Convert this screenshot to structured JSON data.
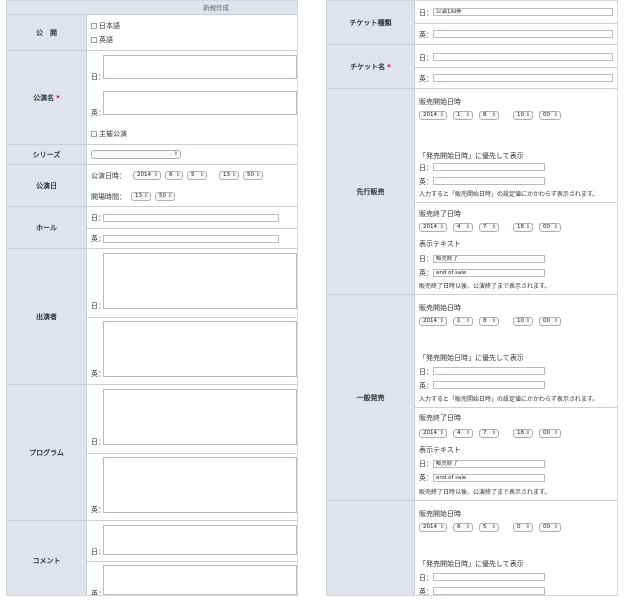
{
  "left": {
    "header": "新規作成",
    "publish": {
      "label": "公　開",
      "options": [
        "日本語",
        "英語"
      ]
    },
    "title": {
      "label": "公演名",
      "ja": "日：",
      "en": "英：",
      "sponsor": "主催公演"
    },
    "series": {
      "label": "シリーズ"
    },
    "date": {
      "label": "公演日",
      "date_label": "公演日時：",
      "open_label": "開場時間：",
      "year": "2014",
      "month": "6",
      "day": "5",
      "hour": "13",
      "minute": "50",
      "open_hour": "13",
      "open_minute": "50"
    },
    "hall": {
      "label": "ホール",
      "ja": "日：",
      "en": "英："
    },
    "performer": {
      "label": "出演者",
      "ja": "日：",
      "en": "英："
    },
    "program": {
      "label": "プログラム",
      "ja": "日：",
      "en": "英："
    },
    "comment": {
      "label": "コメント",
      "ja": "日：",
      "en": "英："
    }
  },
  "right": {
    "ticket_type": {
      "label": "チケット種類",
      "ja": "日：",
      "en": "英：",
      "ja_value": "公演1回券"
    },
    "ticket_name": {
      "label": "チケット名",
      "ja": "日：",
      "en": "英："
    },
    "presale": {
      "label": "先行販売",
      "start_label": "販売開始日時",
      "start": {
        "year": "2014",
        "month": "1",
        "day": "8",
        "hour": "10",
        "minute": "00"
      },
      "priority_label": "「発売開始日時」に優先して表示",
      "ja": "日：",
      "en": "英：",
      "note1": "入力すると「販売開始日時」の設定値にかかわらず表示されます。",
      "end_label": "販売終了日時",
      "end": {
        "year": "2014",
        "month": "4",
        "day": "7",
        "hour": "18",
        "minute": "00"
      },
      "text_label": "表示テキスト",
      "ja_text": "販売終了",
      "en_text": "end of sale",
      "note2": "販売終了日時以後、公演終了まで表示されます。"
    },
    "general": {
      "label": "一般発売",
      "start_label": "販売開始日時",
      "start": {
        "year": "2014",
        "month": "1",
        "day": "8",
        "hour": "10",
        "minute": "00"
      },
      "priority_label": "「発売開始日時」に優先して表示",
      "ja": "日：",
      "en": "英：",
      "note1": "入力すると「販売開始日時」の設定値にかかわらず表示されます。",
      "end_label": "販売終了日時",
      "end": {
        "year": "2014",
        "month": "4",
        "day": "7",
        "hour": "18",
        "minute": "00"
      },
      "text_label": "表示テキスト",
      "ja_text": "販売終了",
      "en_text": "end of sale",
      "note2": "販売終了日時以後、公演終了まで表示されます。"
    },
    "third": {
      "start_label": "販売開始日時",
      "start": {
        "year": "2014",
        "month": "6",
        "day": "5",
        "hour": "0",
        "minute": "00"
      },
      "priority_label": "「発売開始日時」に優先して表示",
      "ja": "日：",
      "en": "英："
    }
  }
}
